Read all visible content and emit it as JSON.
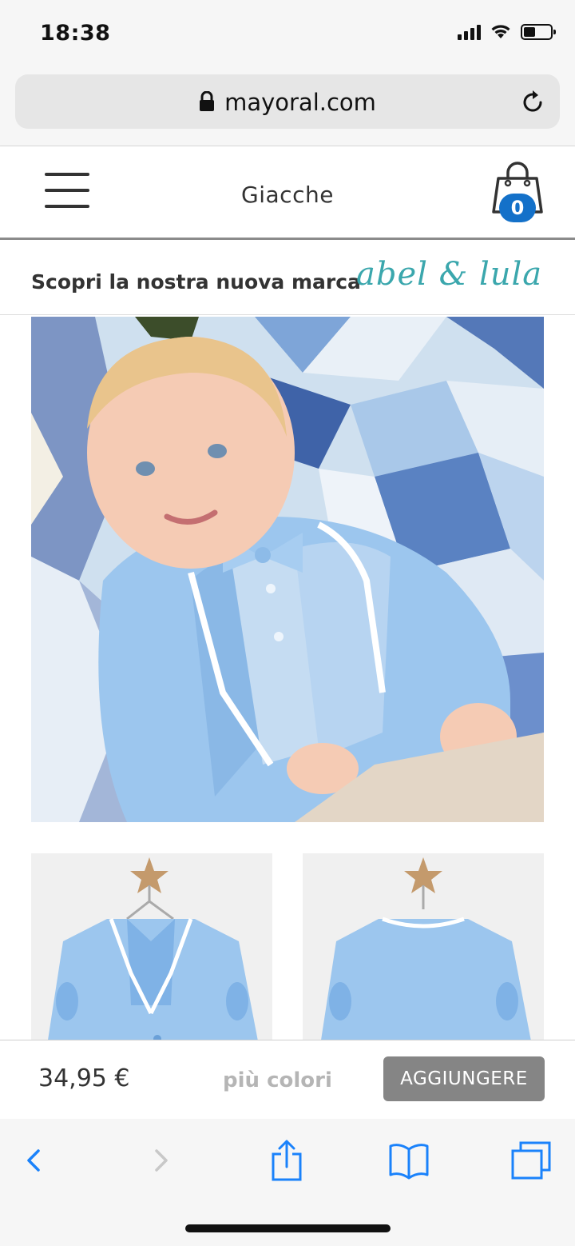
{
  "status_bar": {
    "time": "18:38"
  },
  "browser": {
    "url": "mayoral.com"
  },
  "header": {
    "title": "Giacche",
    "cart_count": "0"
  },
  "promo": {
    "text": "Scopri la nostra nuova marca",
    "brand": "abel & lula"
  },
  "product": {
    "price": "34,95 €",
    "more_colors": "più colori",
    "add_button": "AGGIUNGERE"
  },
  "colors": {
    "accent_blue": "#1471c9",
    "brand_teal": "#3ba7ad",
    "ios_blue": "#1a82fb",
    "button_gray": "#858585",
    "jacket_blue": "#9cc6ee"
  },
  "icons": [
    "lock-icon",
    "reload-icon",
    "hamburger-menu-icon",
    "shopping-bag-icon",
    "back-icon",
    "forward-icon",
    "share-icon",
    "bookmarks-icon",
    "tabs-icon"
  ]
}
